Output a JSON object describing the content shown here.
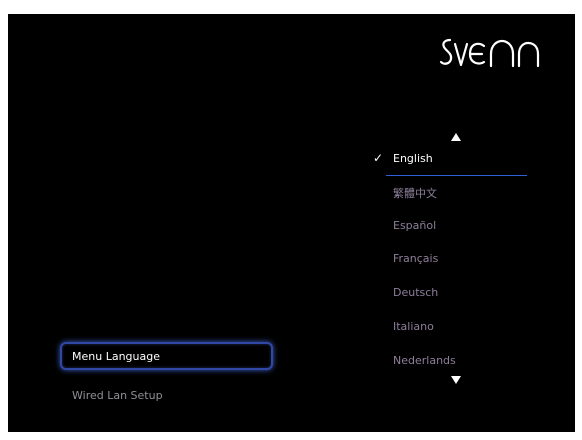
{
  "brand": {
    "logo_text": "sveon"
  },
  "language_menu": {
    "up_arrow_icon": "triangle-up",
    "down_arrow_icon": "triangle-down",
    "selected_mark": "✓",
    "items": [
      {
        "label": "English",
        "selected": true
      },
      {
        "label": "繁體中文",
        "selected": false
      },
      {
        "label": "Español",
        "selected": false
      },
      {
        "label": "Français",
        "selected": false
      },
      {
        "label": "Deutsch",
        "selected": false
      },
      {
        "label": "Italiano",
        "selected": false
      },
      {
        "label": "Nederlands",
        "selected": false
      }
    ]
  },
  "setup_menu": {
    "items": [
      {
        "label": "Menu Language",
        "active": true
      },
      {
        "label": "Wired Lan Setup",
        "active": false
      }
    ]
  },
  "colors": {
    "background": "#000000",
    "highlight_border": "#3047a6",
    "selection_underline": "#2e61d8",
    "unselected_text": "#8c7f9a"
  }
}
